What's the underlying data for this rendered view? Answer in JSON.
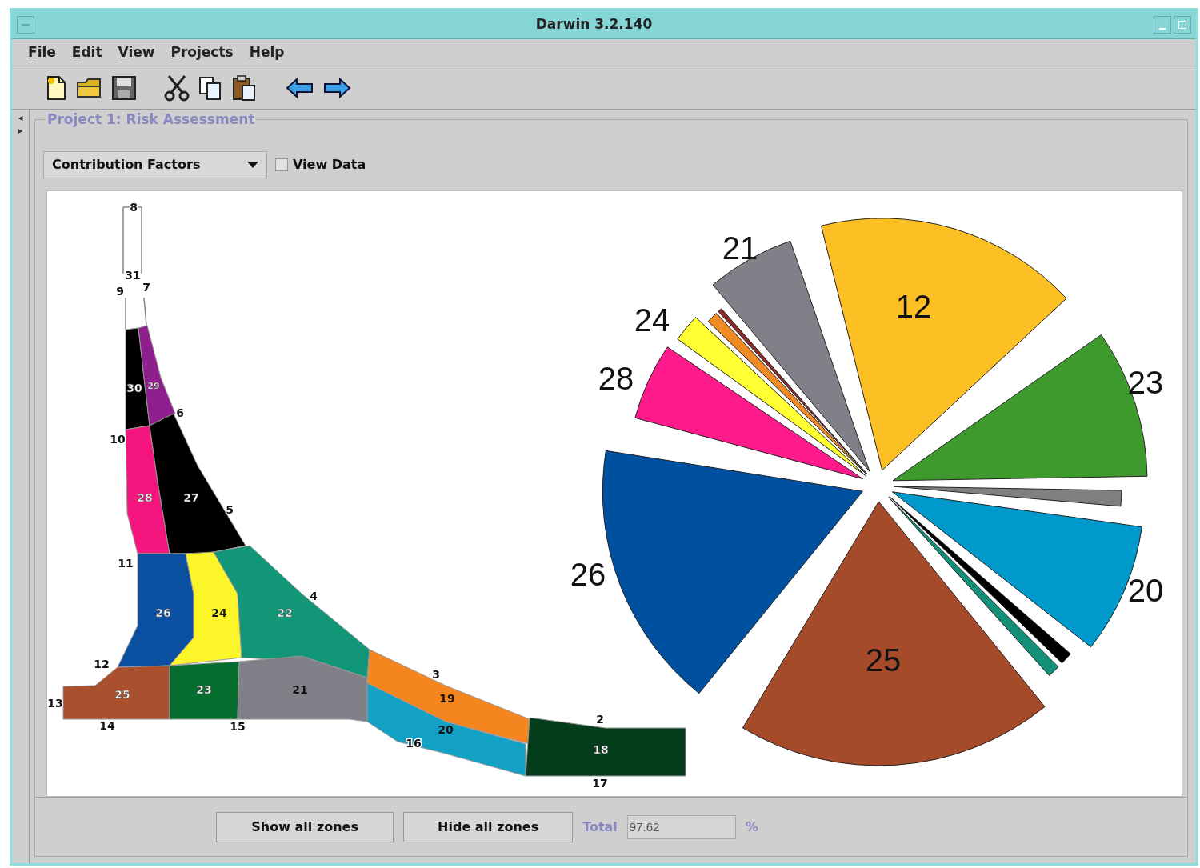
{
  "window": {
    "title": "Darwin 3.2.140"
  },
  "menu": [
    {
      "label": "File"
    },
    {
      "label": "Edit"
    },
    {
      "label": "View"
    },
    {
      "label": "Projects"
    },
    {
      "label": "Help"
    }
  ],
  "project": {
    "title": "Project 1: Risk Assessment",
    "side_arrows": [
      "◂",
      "▸"
    ]
  },
  "controls": {
    "dropdown": "Contribution Factors",
    "view_data": {
      "label": "View Data",
      "checked": false
    }
  },
  "diagram": {
    "zones": [
      {
        "label": "30",
        "color": "#000000"
      },
      {
        "label": "29",
        "color": "#8e1f8c"
      },
      {
        "label": "28",
        "color": "#f5157f"
      },
      {
        "label": "27",
        "color": "#000000"
      },
      {
        "label": "26",
        "color": "#0a4fa0"
      },
      {
        "label": "24",
        "color": "#fcf52a"
      },
      {
        "label": "22",
        "color": "#119677"
      },
      {
        "label": "25",
        "color": "#a9502f"
      },
      {
        "label": "23",
        "color": "#056e2e"
      },
      {
        "label": "21",
        "color": "#808088"
      },
      {
        "label": "19",
        "color": "#f5861f"
      },
      {
        "label": "20",
        "color": "#14a1c6"
      },
      {
        "label": "18",
        "color": "#043d1c"
      }
    ],
    "node_labels": [
      "8",
      "31",
      "9",
      "7",
      "6",
      "10",
      "5",
      "11",
      "4",
      "12",
      "13",
      "14",
      "15",
      "3",
      "16",
      "2",
      "17"
    ]
  },
  "pie": {
    "slices": [
      {
        "label": "12",
        "color": "#fcbf24"
      },
      {
        "label": "23",
        "color": "#3f9a2e"
      },
      {
        "color": "#808080"
      },
      {
        "label": "20",
        "color": "#0099cc"
      },
      {
        "color": "#000000"
      },
      {
        "color": "#14907a"
      },
      {
        "label": "25",
        "color": "#a64b2a"
      },
      {
        "label": "26",
        "color": "#0050a0"
      },
      {
        "label": "28",
        "color": "#ff1a8c"
      },
      {
        "label": "24",
        "color": "#ffff33"
      },
      {
        "color": "#f08a24"
      },
      {
        "color": "#8b2a2a"
      },
      {
        "label": "21",
        "color": "#808088"
      }
    ]
  },
  "footer": {
    "buttons": [
      "Show all zones",
      "Hide all zones"
    ],
    "total_label": "Total",
    "total_value": "97.62",
    "unit": "%"
  }
}
